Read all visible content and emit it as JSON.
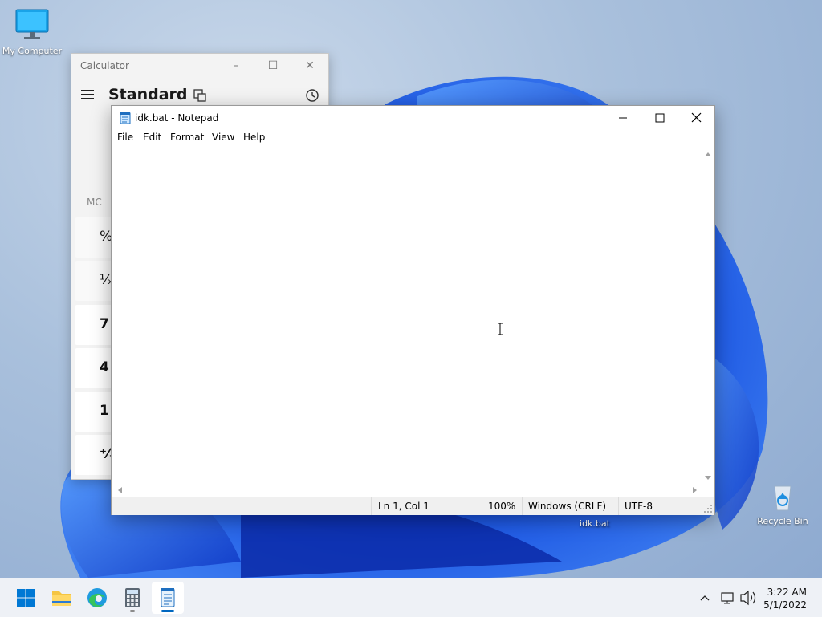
{
  "desktop": {
    "icons": [
      {
        "label": "My Computer"
      },
      {
        "label": "Recycle Bin"
      },
      {
        "label": "idk.bat"
      }
    ]
  },
  "calculator": {
    "title": "Calculator",
    "mode": "Standard",
    "memory_label": "MC",
    "keys": [
      "%",
      "¹⁄ₓ",
      "7",
      "4",
      "1",
      "⁺⁄₋"
    ]
  },
  "notepad": {
    "title": "idk.bat - Notepad",
    "menu": [
      "File",
      "Edit",
      "Format",
      "View",
      "Help"
    ],
    "content": "",
    "status": {
      "position": "Ln 1, Col 1",
      "zoom": "100%",
      "line_ending": "Windows (CRLF)",
      "encoding": "UTF-8"
    }
  },
  "taskbar": {
    "apps": [
      "start-icon",
      "file-explorer-icon",
      "edge-icon",
      "calculator-icon",
      "notepad-icon"
    ],
    "clock": {
      "time": "3:22 AM",
      "date": "5/1/2022"
    }
  },
  "colors": {
    "accent": "#0067c0",
    "wallpaper_blue": "#1f4fd8"
  }
}
